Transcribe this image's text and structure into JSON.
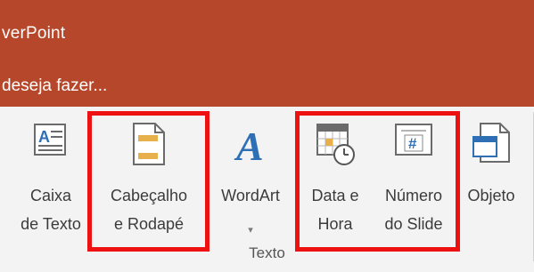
{
  "titlebar": {
    "app_title": "verPoint"
  },
  "tellme": {
    "placeholder": "deseja fazer..."
  },
  "ribbon": {
    "group_label": "Texto",
    "commands": [
      {
        "id": "caixa-de-texto",
        "line1": "Caixa",
        "line2": "de Texto",
        "icon": "text-box-icon"
      },
      {
        "id": "cabecalho-rodape",
        "line1": "Cabeçalho",
        "line2": "e Rodapé",
        "icon": "header-footer-icon"
      },
      {
        "id": "wordart",
        "line1": "WordArt",
        "line2": "",
        "icon": "wordart-icon",
        "dropdown": "▾"
      },
      {
        "id": "data-hora",
        "line1": "Data e",
        "line2": "Hora",
        "icon": "date-time-icon"
      },
      {
        "id": "numero-slide",
        "line1": "Número",
        "line2": "do Slide",
        "icon": "slide-number-icon",
        "icon_text": "#"
      },
      {
        "id": "objeto",
        "line1": "Objeto",
        "line2": "",
        "icon": "object-icon"
      }
    ]
  },
  "colors": {
    "titlebar_bg": "#b7472a",
    "ribbon_bg": "#f3f3f3",
    "highlight": "#ee1111",
    "icon_orange": "#e8b04a",
    "icon_blue": "#2f6fb5"
  }
}
